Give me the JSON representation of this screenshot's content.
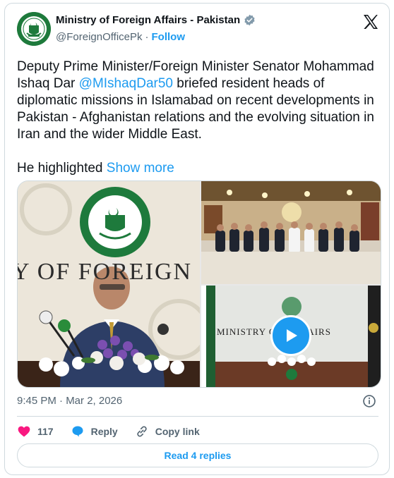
{
  "account": {
    "name": "Ministry of Foreign Affairs - Pakistan",
    "handle": "@ForeignOfficePk",
    "separator": "·",
    "follow_label": "Follow"
  },
  "tweet": {
    "text_before_mention": "Deputy Prime Minister/Foreign Minister Senator Mohammad Ishaq Dar ",
    "mention": "@MIshaqDar50",
    "text_after_mention": " briefed resident heads of diplomatic missions in Islamabad on recent developments in Pakistan - Afghanistan relations and the evolving situation in Iran and the wider Middle East.",
    "second_para": "He highlighted ",
    "show_more": "Show more"
  },
  "media": {
    "left_sign_text": "Y OF FOREIGN",
    "video_sign_text": "MINISTRY O         N AFFAIRS"
  },
  "meta": {
    "timestamp": "9:45 PM · Mar 2, 2026"
  },
  "actions": {
    "like_count": "117",
    "reply_label": "Reply",
    "copy_link_label": "Copy link",
    "read_replies_label": "Read 4 replies"
  },
  "colors": {
    "accent": "#1d9bf0",
    "like": "#f91880",
    "text": "#0f1419",
    "muted": "#536471"
  }
}
